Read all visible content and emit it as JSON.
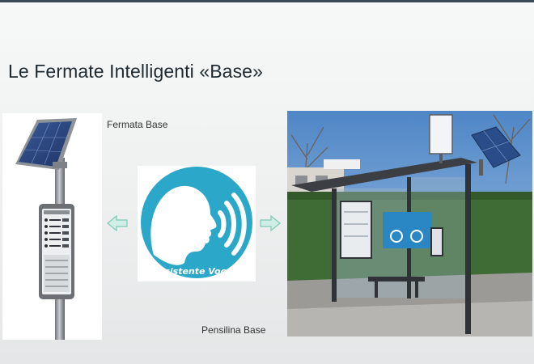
{
  "slide": {
    "title": "Le Fermate Intelligenti «Base»"
  },
  "labels": {
    "fermata": "Fermata Base",
    "pensilina": "Pensilina Base"
  },
  "voice": {
    "caption": "Assistente Vocale",
    "color": "#2aa7c9"
  },
  "colors": {
    "accent_arrow": "#9fd9cc",
    "title": "#1e2a30"
  },
  "icons": {
    "left_arrow": "arrow-left-icon",
    "right_arrow": "arrow-right-icon",
    "voice": "voice-assistant-icon"
  }
}
